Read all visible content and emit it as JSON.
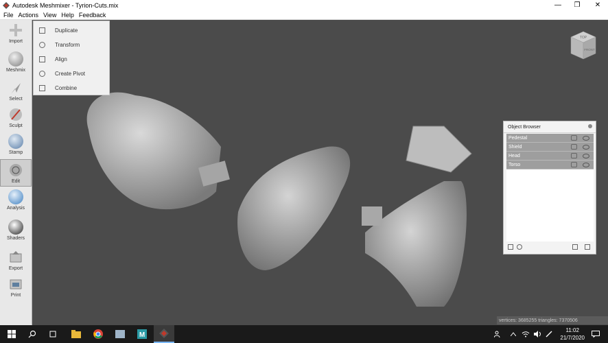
{
  "window": {
    "title": "Autodesk Meshmixer - Tyrion-Cuts.mix",
    "min_glyph": "—",
    "max_glyph": "❐",
    "close_glyph": "✕"
  },
  "menu": [
    "File",
    "Actions",
    "View",
    "Help",
    "Feedback"
  ],
  "toolbar": [
    {
      "label": "Import",
      "icon": "plus-icon"
    },
    {
      "label": "Meshmix",
      "icon": "meshmix-icon"
    },
    {
      "label": "Select",
      "icon": "select-arrow-icon"
    },
    {
      "label": "Sculpt",
      "icon": "sculpt-brush-icon"
    },
    {
      "label": "Stamp",
      "icon": "stamp-icon"
    },
    {
      "label": "Edit",
      "icon": "edit-icon",
      "active": true
    },
    {
      "label": "Analysis",
      "icon": "analysis-icon"
    },
    {
      "label": "Shaders",
      "icon": "shaders-icon"
    },
    {
      "label": "Export",
      "icon": "export-icon"
    },
    {
      "label": "Print",
      "icon": "print-icon"
    }
  ],
  "edit_menu": [
    "Duplicate",
    "Transform",
    "Align",
    "Create Pivot",
    "Combine"
  ],
  "object_browser": {
    "title": "Object Browser",
    "objects": [
      "Pedestal",
      "Shield",
      "Head",
      "Torso"
    ]
  },
  "viewcube": {
    "top": "TOP",
    "front": "FRONT"
  },
  "status": "vertices: 3685255 triangles: 7370506",
  "taskbar": {
    "time": "11:02",
    "date": "21/7/2020"
  },
  "colors": {
    "viewport": "#4b4b4b",
    "object_row": "#9e9e9e",
    "taskbar": "#1a1a1a"
  }
}
